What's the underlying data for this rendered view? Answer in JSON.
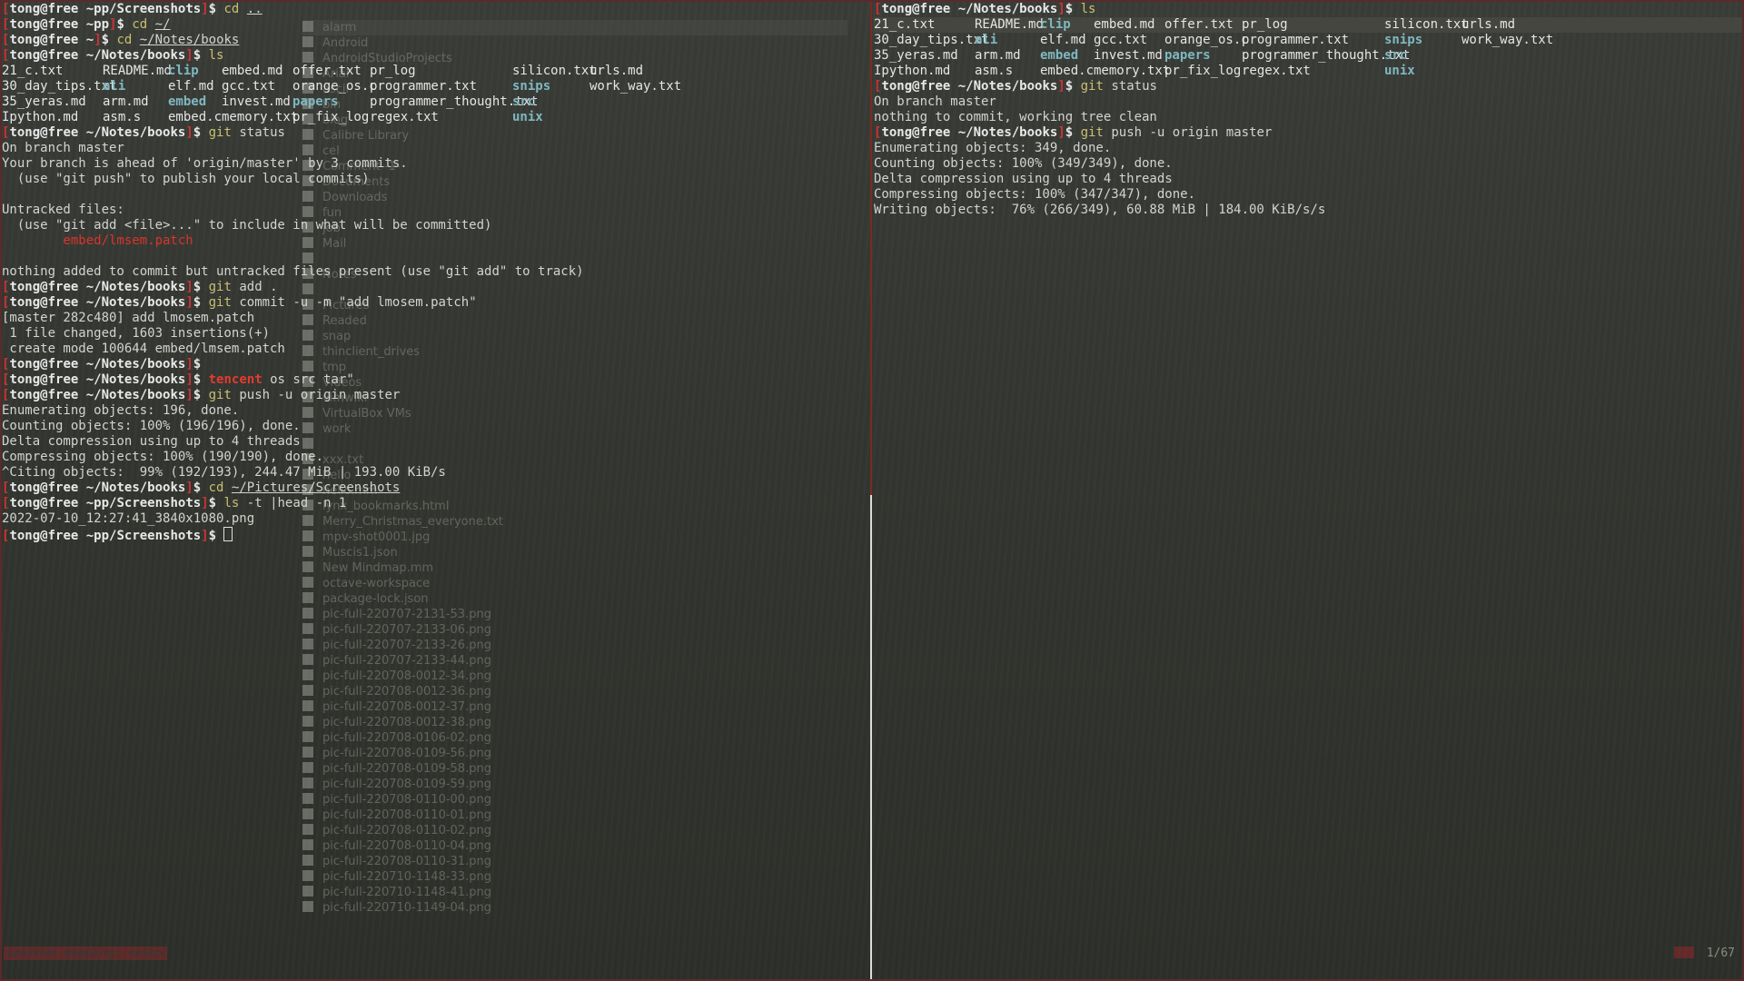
{
  "prompt": {
    "user": "tong",
    "host": "free"
  },
  "left": {
    "lines": [
      {
        "kind": "prompt",
        "path": "~pp/Screenshots",
        "cmd": "cd",
        "arg": "..",
        "arg_u": true
      },
      {
        "kind": "prompt",
        "path": "~pp",
        "cmd": "cd",
        "arg": "~/",
        "arg_u": true
      },
      {
        "kind": "prompt",
        "path": "~",
        "cmd": "cd",
        "arg": "~/Notes/books",
        "arg_u": true
      },
      {
        "kind": "prompt",
        "path": "~/Notes/books",
        "cmd": "ls",
        "arg": ""
      },
      {
        "kind": "ls",
        "cols": [
          [
            "21_c.txt",
            "file"
          ],
          [
            "README.md",
            "file"
          ],
          [
            "clip",
            "dir"
          ],
          [
            "embed.md",
            "file"
          ],
          [
            "offer.txt",
            "file"
          ],
          [
            "pr_log",
            "file"
          ],
          [
            "silicon.txt",
            "file"
          ],
          [
            "urls.md",
            "file"
          ]
        ]
      },
      {
        "kind": "ls",
        "cols": [
          [
            "30_day_tips.txt",
            "file"
          ],
          [
            "ali",
            "dir"
          ],
          [
            "elf.md",
            "file"
          ],
          [
            "gcc.txt",
            "file"
          ],
          [
            "orange_os.c",
            "file"
          ],
          [
            "programmer.txt",
            "file"
          ],
          [
            "snips",
            "dir"
          ],
          [
            "work_way.txt",
            "file"
          ]
        ]
      },
      {
        "kind": "ls",
        "cols": [
          [
            "35_yeras.md",
            "file"
          ],
          [
            "arm.md",
            "file"
          ],
          [
            "embed",
            "dir"
          ],
          [
            "invest.md",
            "file"
          ],
          [
            "papers",
            "dir"
          ],
          [
            "programmer_thought.txt",
            "file"
          ],
          [
            "src",
            "dir"
          ],
          [
            "",
            ""
          ]
        ]
      },
      {
        "kind": "ls",
        "cols": [
          [
            "Ipython.md",
            "file"
          ],
          [
            "asm.s",
            "file"
          ],
          [
            "embed.c",
            "file"
          ],
          [
            "memory.txt",
            "file"
          ],
          [
            "pr_fix_log",
            "file"
          ],
          [
            "regex.txt",
            "file"
          ],
          [
            "unix",
            "dir"
          ],
          [
            "",
            ""
          ]
        ]
      },
      {
        "kind": "prompt",
        "path": "~/Notes/books",
        "cmd": "git",
        "arg": "status"
      },
      {
        "kind": "text",
        "text": "On branch master"
      },
      {
        "kind": "text",
        "text": "Your branch is ahead of 'origin/master' by 3 commits."
      },
      {
        "kind": "text",
        "text": "  (use \"git push\" to publish your local commits)"
      },
      {
        "kind": "text",
        "text": ""
      },
      {
        "kind": "text",
        "text": "Untracked files:"
      },
      {
        "kind": "text",
        "text": "  (use \"git add <file>...\" to include in what will be committed)"
      },
      {
        "kind": "red",
        "text": "        embed/lmsem.patch"
      },
      {
        "kind": "text",
        "text": ""
      },
      {
        "kind": "text",
        "text": "nothing added to commit but untracked files present (use \"git add\" to track)"
      },
      {
        "kind": "prompt",
        "path": "~/Notes/books",
        "cmd": "git",
        "arg": "add .",
        "arg_u": false
      },
      {
        "kind": "prompt",
        "path": "~/Notes/books",
        "cmd": "git",
        "arg": "commit -u -m \"add lmosem.patch\"",
        "quoted": true
      },
      {
        "kind": "text",
        "text": "[master 282c480] add lmosem.patch"
      },
      {
        "kind": "text",
        "text": " 1 file changed, 1603 insertions(+)"
      },
      {
        "kind": "text",
        "text": " create mode 100644 embed/lmsem.patch"
      },
      {
        "kind": "prompt",
        "path": "~/Notes/books",
        "cmd": "",
        "arg": ""
      },
      {
        "kind": "prompt",
        "path": "~/Notes/books",
        "cmd": "tencent",
        "arg": "os src tar\"",
        "red": true
      },
      {
        "kind": "prompt",
        "path": "~/Notes/books",
        "cmd": "git",
        "arg": "push -u origin master"
      },
      {
        "kind": "text",
        "text": "Enumerating objects: 196, done."
      },
      {
        "kind": "text",
        "text": "Counting objects: 100% (196/196), done."
      },
      {
        "kind": "text",
        "text": "Delta compression using up to 4 threads"
      },
      {
        "kind": "text",
        "text": "Compressing objects: 100% (190/190), done."
      },
      {
        "kind": "text",
        "text": "^Citing objects:  99% (192/193), 244.47 MiB | 193.00 KiB/s"
      },
      {
        "kind": "prompt",
        "path": "~/Notes/books",
        "cmd": "cd",
        "arg": "~/Pictures/Screenshots",
        "arg_u": true
      },
      {
        "kind": "prompt",
        "path": "~pp/Screenshots",
        "cmd": "ls",
        "arg": "-t |head -n 1"
      },
      {
        "kind": "text",
        "text": "2022-07-10_12:27:41_3840x1080.png"
      },
      {
        "kind": "cursorprompt",
        "path": "~pp/Screenshots"
      }
    ]
  },
  "right": {
    "lines": [
      {
        "kind": "prompt",
        "path": "~/Notes/books",
        "cmd": "ls",
        "arg": ""
      },
      {
        "kind": "ls",
        "cols": [
          [
            "21_c.txt",
            "file"
          ],
          [
            "README.md",
            "file"
          ],
          [
            "clip",
            "dir"
          ],
          [
            "embed.md",
            "file"
          ],
          [
            "offer.txt",
            "file"
          ],
          [
            "pr_log",
            "file"
          ],
          [
            "silicon.txt",
            "file"
          ],
          [
            "urls.md",
            "file"
          ]
        ],
        "hl": true
      },
      {
        "kind": "ls",
        "cols": [
          [
            "30_day_tips.txt",
            "file"
          ],
          [
            "ali",
            "dir"
          ],
          [
            "elf.md",
            "file"
          ],
          [
            "gcc.txt",
            "file"
          ],
          [
            "orange_os.c",
            "file"
          ],
          [
            "programmer.txt",
            "file"
          ],
          [
            "snips",
            "dir"
          ],
          [
            "work_way.txt",
            "file"
          ]
        ]
      },
      {
        "kind": "ls",
        "cols": [
          [
            "35_yeras.md",
            "file"
          ],
          [
            "arm.md",
            "file"
          ],
          [
            "embed",
            "dir"
          ],
          [
            "invest.md",
            "file"
          ],
          [
            "papers",
            "dir"
          ],
          [
            "programmer_thought.txt",
            "file"
          ],
          [
            "src",
            "dir"
          ],
          [
            "",
            ""
          ]
        ]
      },
      {
        "kind": "ls",
        "cols": [
          [
            "Ipython.md",
            "file"
          ],
          [
            "asm.s",
            "file"
          ],
          [
            "embed.c",
            "file"
          ],
          [
            "memory.txt",
            "file"
          ],
          [
            "pr_fix_log",
            "file"
          ],
          [
            "regex.txt",
            "file"
          ],
          [
            "unix",
            "dir"
          ],
          [
            "",
            ""
          ]
        ]
      },
      {
        "kind": "prompt",
        "path": "~/Notes/books",
        "cmd": "git",
        "arg": "status"
      },
      {
        "kind": "text",
        "text": "On branch master"
      },
      {
        "kind": "text",
        "text": "nothing to commit, working tree clean"
      },
      {
        "kind": "prompt",
        "path": "~/Notes/books",
        "cmd": "git",
        "arg": "push -u origin master"
      },
      {
        "kind": "text",
        "text": "Enumerating objects: 349, done."
      },
      {
        "kind": "text",
        "text": "Counting objects: 100% (349/349), done."
      },
      {
        "kind": "text",
        "text": "Delta compression using up to 4 threads"
      },
      {
        "kind": "text",
        "text": "Compressing objects: 100% (347/347), done."
      },
      {
        "kind": "text",
        "text": "Writing objects:  76% (266/349), 60.88 MiB | 184.00 KiB/s/s"
      }
    ]
  },
  "ghost_files": [
    "alarm",
    "Android",
    "AndroidStudioProjects",
    "Arial",
    "ascii",
    "bin",
    "blog",
    "Calibre Library",
    "cel",
    "Comment -1-",
    "Documents",
    "Downloads",
    "fun",
    "job",
    "Mail",
    "",
    "Notes",
    "",
    "Pictures",
    "Readed",
    "snap",
    "thinclient_drives",
    "tmp",
    "Videos",
    "vimwiki",
    "VirtualBox VMs",
    "work",
    "",
    "xxx.txt",
    "hello",
    "hello.mm",
    "lynx_bookmarks.html",
    "Merry_Christmas_everyone.txt",
    "mpv-shot0001.jpg",
    "Muscis1.json",
    "New Mindmap.mm",
    "octave-workspace",
    "package-lock.json",
    "pic-full-220707-2131-53.png",
    "pic-full-220707-2133-06.png",
    "pic-full-220707-2133-26.png",
    "pic-full-220707-2133-44.png",
    "pic-full-220708-0012-34.png",
    "pic-full-220708-0012-36.png",
    "pic-full-220708-0012-37.png",
    "pic-full-220708-0012-38.png",
    "pic-full-220708-0106-02.png",
    "pic-full-220708-0109-56.png",
    "pic-full-220708-0109-58.png",
    "pic-full-220708-0109-59.png",
    "pic-full-220708-0110-00.png",
    "pic-full-220708-0110-01.png",
    "pic-full-220708-0110-02.png",
    "pic-full-220708-0110-04.png",
    "pic-full-220708-0110-31.png",
    "pic-full-220710-1148-33.png",
    "pic-full-220710-1148-41.png",
    "pic-full-220710-1149-04.png"
  ],
  "status": {
    "left": "unknown mapping: <esc>",
    "right": "1/67"
  }
}
